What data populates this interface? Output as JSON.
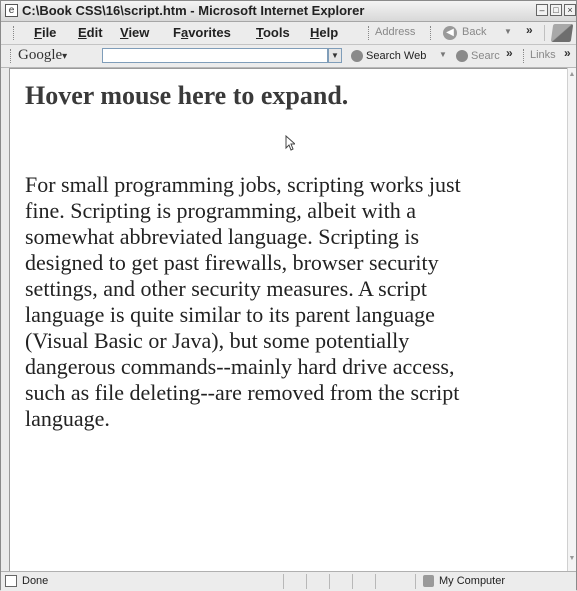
{
  "window": {
    "title": "C:\\Book CSS\\16\\script.htm - Microsoft Internet Explorer",
    "buttons": {
      "minimize": "–",
      "maximize": "□",
      "close": "×"
    }
  },
  "menubar": {
    "items": [
      {
        "label": "File",
        "accel": "F",
        "rest": "ile"
      },
      {
        "label": "Edit",
        "accel": "E",
        "rest": "dit"
      },
      {
        "label": "View",
        "accel": "V",
        "rest": "iew"
      },
      {
        "label": "Favorites",
        "pre": "F",
        "accel": "a",
        "rest": "vorites"
      },
      {
        "label": "Tools",
        "accel": "T",
        "rest": "ools"
      },
      {
        "label": "Help",
        "accel": "H",
        "rest": "elp"
      }
    ],
    "address_label": "Address",
    "back_label": "Back",
    "chevron": "»"
  },
  "googlebar": {
    "logo": "Google",
    "logo_arrow": "▾",
    "search_value": "",
    "search_web_label": "Search Web",
    "search_site_label": "Searc",
    "chevron": "»",
    "links_label": "Links",
    "links_chevron": "»"
  },
  "page": {
    "heading": "Hover mouse here to expand.",
    "paragraph": "For small programming jobs, scripting works just fine. Scripting is programming, albeit with a somewhat abbreviated language. Scripting is designed to get past firewalls, browser security settings, and other security measures. A script language is quite similar to its parent language (Visual Basic or Java), but some potentially dangerous commands--mainly hard drive access, such as file deleting--are removed from the script language."
  },
  "statusbar": {
    "status": "Done",
    "zone": "My Computer"
  }
}
